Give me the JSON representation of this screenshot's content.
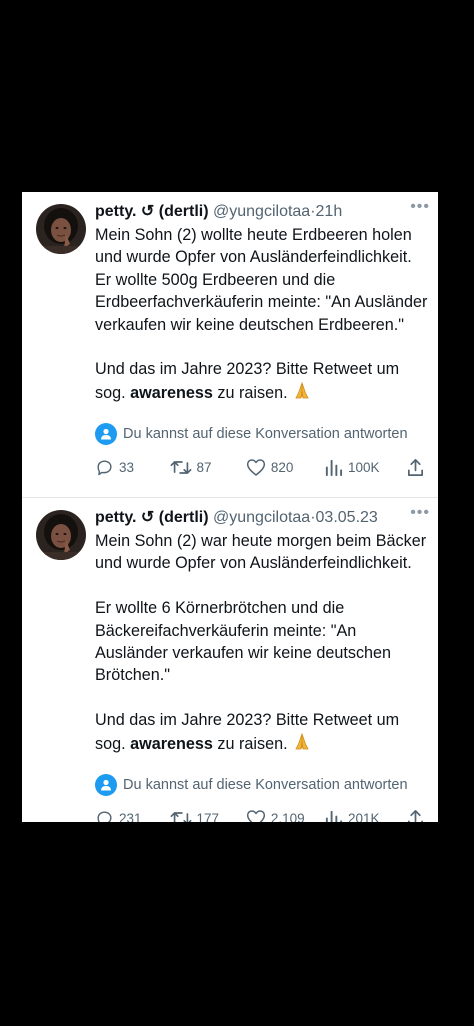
{
  "tweets": [
    {
      "display_name": "petty. ↺ (dertli)",
      "handle": "@yungcilotaa",
      "separator": "·",
      "time": "21h",
      "paragraphs": [
        {
          "text": "Mein Sohn (2) wollte heute Erdbeeren holen und wurde Opfer von Ausländerfeindlichkeit. Er wollte 500g Erdbeeren und die Erdbeerfachverkäuferin meinte:  \"An Ausländer verkaufen wir keine deutschen Erdbeeren.\""
        },
        {
          "before": "Und das im Jahre 2023? Bitte Retweet um sog. ",
          "bold": "awareness",
          "after": " zu raisen. "
        }
      ],
      "reply_notice": "Du kannst auf diese Konversation antworten",
      "stats": {
        "replies": "33",
        "retweets": "87",
        "likes": "820",
        "views": "100K"
      }
    },
    {
      "display_name": "petty. ↺ (dertli)",
      "handle": "@yungcilotaa",
      "separator": "·",
      "time": "03.05.23",
      "paragraphs": [
        {
          "text": "Mein Sohn (2) war heute morgen beim Bäcker und wurde Opfer von Ausländerfeindlichkeit."
        },
        {
          "text": "Er wollte 6 Körnerbrötchen und die Bäckereifachverkäuferin meinte:  \"An Ausländer verkaufen wir keine deutschen Brötchen.\""
        },
        {
          "before": "Und das im Jahre 2023? Bitte Retweet um sog. ",
          "bold": "awareness",
          "after": " zu raisen. "
        }
      ],
      "reply_notice": "Du kannst auf diese Konversation antworten",
      "stats": {
        "replies": "231",
        "retweets": "177",
        "likes": "2.109",
        "views": "201K"
      }
    }
  ],
  "icons": {
    "more": "more-icon",
    "reply_notice": "person-icon",
    "reply": "reply-icon",
    "retweet": "retweet-icon",
    "like": "heart-icon",
    "views": "views-icon",
    "share": "share-icon",
    "emoji": "folded-hands-emoji"
  },
  "colors": {
    "background": "#000000",
    "card": "#ffffff",
    "text": "#0f1419",
    "secondary": "#536471",
    "accent": "#1d9bf0"
  }
}
